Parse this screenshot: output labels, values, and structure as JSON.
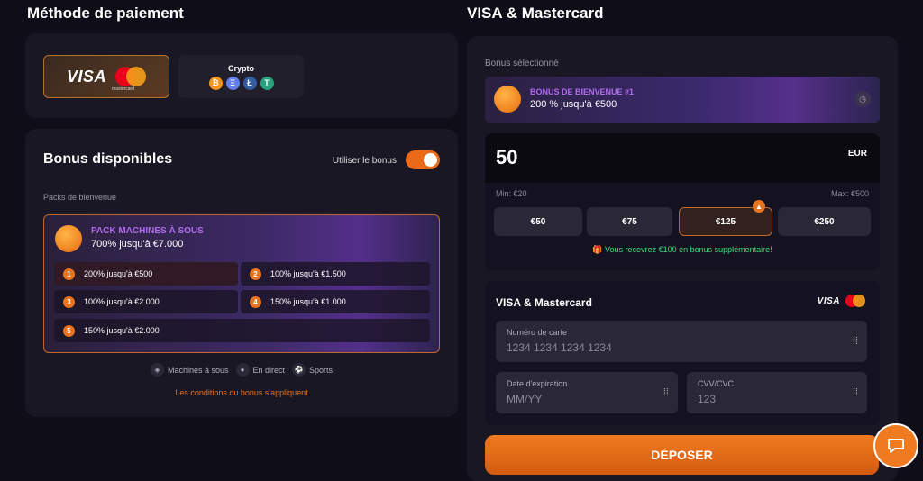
{
  "headers": {
    "left_title": "Méthode de paiement",
    "right_title": "VISA & Mastercard"
  },
  "payment_methods": {
    "visa_label": "VISA",
    "mastercard_label": "mastercard",
    "crypto_label": "Crypto",
    "crypto_coins": [
      "₿",
      "Ξ",
      "Ł",
      "T"
    ]
  },
  "bonuses": {
    "title": "Bonus disponibles",
    "toggle_label": "Utiliser le bonus",
    "toggle_on": true,
    "packs_label": "Packs de bienvenue",
    "pack_name": "PACK MACHINES À SOUS",
    "pack_desc": "700% jusqu'à €7.000",
    "tiers": [
      {
        "n": "1",
        "text": "200% jusqu'à €500"
      },
      {
        "n": "2",
        "text": "100% jusqu'à €1.500"
      },
      {
        "n": "3",
        "text": "100% jusqu'à €2.000"
      },
      {
        "n": "4",
        "text": "150% jusqu'à €1.000"
      },
      {
        "n": "5",
        "text": "150% jusqu'à €2.000"
      }
    ],
    "categories": [
      "Machines à sous",
      "En direct",
      "Sports"
    ],
    "conditions": "Les conditions du bonus s'appliquent"
  },
  "deposit_panel": {
    "selected_label": "Bonus sélectionné",
    "selected_name": "BONUS DE BIENVENUE #1",
    "selected_desc": "200 % jusqu'à €500",
    "amount": "50",
    "currency": "EUR",
    "min": "Min: €20",
    "max": "Max: €500",
    "chips": [
      "€50",
      "€75",
      "€125",
      "€250"
    ],
    "extra_bonus": "Vous recevrez €100 en bonus supplémentaire!",
    "card_title": "VISA & Mastercard",
    "card_number_label": "Numéro de carte",
    "card_number_placeholder": "1234 1234 1234 1234",
    "expiry_label": "Date d'expiration",
    "expiry_placeholder": "MM/YY",
    "cvv_label": "CVV/CVC",
    "cvv_placeholder": "123",
    "deposit_button": "DÉPOSER"
  },
  "colors": {
    "accent": "#e8741e",
    "purple": "#b26cf0",
    "success": "#3ee07a"
  }
}
